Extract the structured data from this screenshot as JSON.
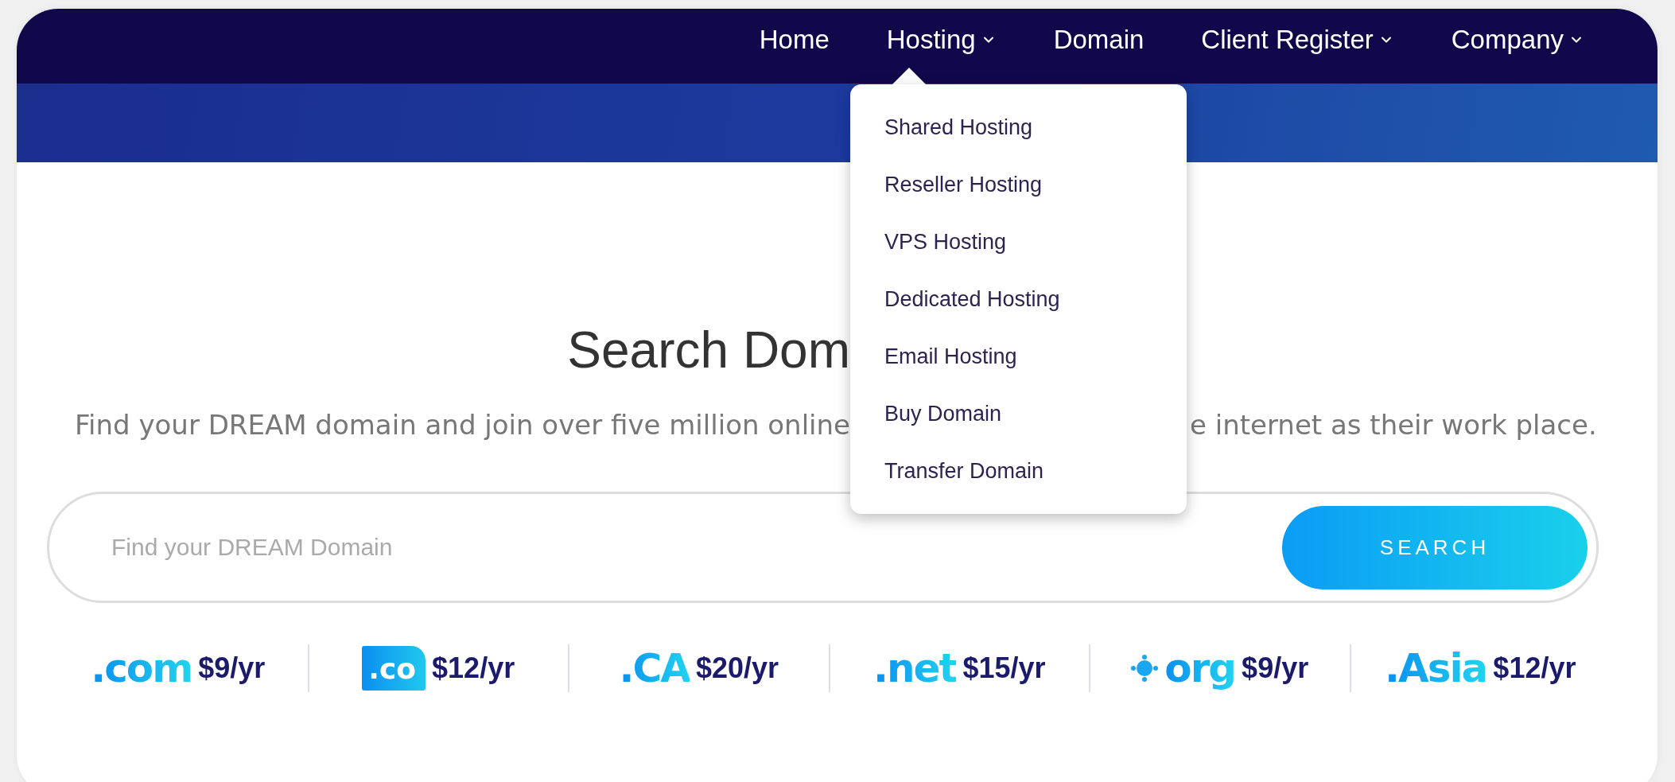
{
  "nav": [
    {
      "label": "Home",
      "has_menu": false
    },
    {
      "label": "Hosting",
      "has_menu": true
    },
    {
      "label": "Domain",
      "has_menu": false
    },
    {
      "label": "Client Register",
      "has_menu": true
    },
    {
      "label": "Company",
      "has_menu": true
    }
  ],
  "hosting_menu": {
    "open": true,
    "items": [
      "Shared Hosting",
      "Reseller Hosting",
      "VPS Hosting",
      "Dedicated Hosting",
      "Email Hosting",
      "Buy Domain",
      "Transfer Domain"
    ]
  },
  "heading": "Search Dom",
  "subtitle_left": "Find your DREAM domain and join over five million online",
  "subtitle_right": "e internet as their work place.",
  "search": {
    "placeholder": "Find your DREAM Domain",
    "button": "SEARCH"
  },
  "domains": [
    {
      "tld": ".com",
      "kind": "plain",
      "price": "$9/yr"
    },
    {
      "tld": ".co",
      "kind": "boxed",
      "price": "$12/yr"
    },
    {
      "tld": ".CA",
      "kind": "plain",
      "price": "$20/yr"
    },
    {
      "tld": ".net",
      "kind": "plain",
      "price": "$15/yr"
    },
    {
      "tld": "org",
      "kind": "emblem",
      "price": "$9/yr"
    },
    {
      "tld": ".Asia",
      "kind": "plain",
      "price": "$12/yr"
    }
  ]
}
